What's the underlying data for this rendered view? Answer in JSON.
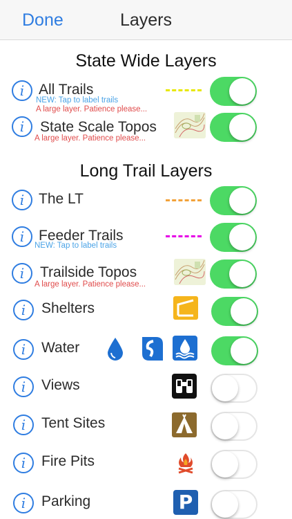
{
  "navbar": {
    "done_label": "Done",
    "title": "Layers"
  },
  "sections": {
    "state_wide": "State Wide Layers",
    "long_trail": "Long Trail Layers"
  },
  "rows": {
    "all_trails": {
      "label": "All Trails",
      "note_blue": "NEW: Tap to label trails",
      "note_red": "A large layer. Patience please...",
      "on": true
    },
    "state_topos": {
      "label": "State Scale Topos",
      "note_red": "A large layer. Patience please...",
      "on": true
    },
    "the_lt": {
      "label": "The LT",
      "on": true
    },
    "feeder_trails": {
      "label": "Feeder Trails",
      "note_blue": "NEW: Tap to label trails",
      "on": true
    },
    "trailside_topos": {
      "label": "Trailside Topos",
      "note_red": "A large layer. Patience please...",
      "on": true
    },
    "shelters": {
      "label": "Shelters",
      "on": true
    },
    "water": {
      "label": "Water",
      "on": true
    },
    "views": {
      "label": "Views",
      "on": false
    },
    "tent_sites": {
      "label": "Tent Sites",
      "on": false
    },
    "fire_pits": {
      "label": "Fire Pits",
      "on": false
    },
    "parking": {
      "label": "Parking",
      "on": false
    }
  },
  "info_glyph": "i",
  "colors": {
    "accent": "#2f7de1",
    "toggle_on": "#4cd964",
    "all_trails_line": "#e8e800",
    "lt_line": "#f2a23a",
    "feeder_line": "#e600e6",
    "shelter": "#f5b51c",
    "water": "#1d6fd1",
    "tent": "#8c6a2d",
    "parking": "#1f5fb0",
    "fire": "#e04b2b"
  },
  "icons": {
    "parking_letter": "P"
  }
}
